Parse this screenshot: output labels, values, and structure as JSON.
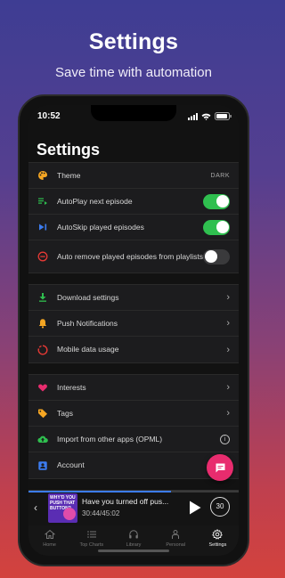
{
  "promo": {
    "title": "Settings",
    "subtitle": "Save time with automation"
  },
  "status": {
    "time": "10:52"
  },
  "page": {
    "title": "Settings"
  },
  "sections": {
    "appearance": {
      "theme": {
        "label": "Theme",
        "value": "DARK"
      },
      "autoplay": {
        "label": "AutoPlay next episode",
        "on": true
      },
      "autoskip": {
        "label": "AutoSkip played episodes",
        "on": true
      },
      "autoremove": {
        "label": "Auto remove played episodes from playlists",
        "on": false
      }
    },
    "downloads": {
      "download": "Download settings",
      "push": "Push Notifications",
      "mobile": "Mobile data usage"
    },
    "library": {
      "interests": "Interests",
      "tags": "Tags",
      "import": "Import from other apps (OPML)",
      "account": "Account"
    }
  },
  "player": {
    "title": "Have you turned off pus...",
    "time": "30:44/45:02",
    "skip": "30",
    "progress": 0.68,
    "art_text": "WHY'D YOU PUSH THAT BUTTON?"
  },
  "tabs": [
    "Home",
    "Top Charts",
    "Library",
    "Personal",
    "Settings"
  ],
  "colors": {
    "accent": "#2fbf4f",
    "fab": "#e82c6e"
  }
}
